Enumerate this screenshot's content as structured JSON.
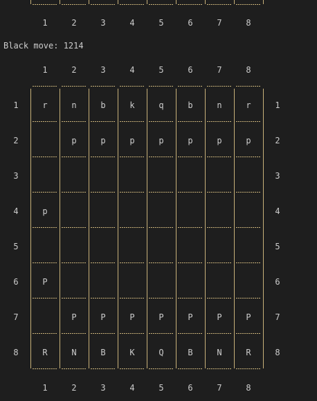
{
  "top_axis": {
    "labels": [
      "1",
      "2",
      "3",
      "4",
      "5",
      "6",
      "7",
      "8"
    ]
  },
  "move_line": "Black move: 1214",
  "board": {
    "col_labels": [
      "1",
      "2",
      "3",
      "4",
      "5",
      "6",
      "7",
      "8"
    ],
    "row_labels": [
      "1",
      "2",
      "3",
      "4",
      "5",
      "6",
      "7",
      "8"
    ],
    "rows": [
      [
        "r",
        "n",
        "b",
        "k",
        "q",
        "b",
        "n",
        "r"
      ],
      [
        "",
        "p",
        "p",
        "p",
        "p",
        "p",
        "p",
        "p"
      ],
      [
        "",
        "",
        "",
        "",
        "",
        "",
        "",
        ""
      ],
      [
        "p",
        "",
        "",
        "",
        "",
        "",
        "",
        ""
      ],
      [
        "",
        "",
        "",
        "",
        "",
        "",
        "",
        ""
      ],
      [
        "P",
        "",
        "",
        "",
        "",
        "",
        "",
        ""
      ],
      [
        "",
        "P",
        "P",
        "P",
        "P",
        "P",
        "P",
        "P"
      ],
      [
        "R",
        "N",
        "B",
        "K",
        "Q",
        "B",
        "N",
        "R"
      ]
    ],
    "grid_color": "#c9b27a",
    "text_color": "#cccccc",
    "background": "#1e1e1e"
  }
}
